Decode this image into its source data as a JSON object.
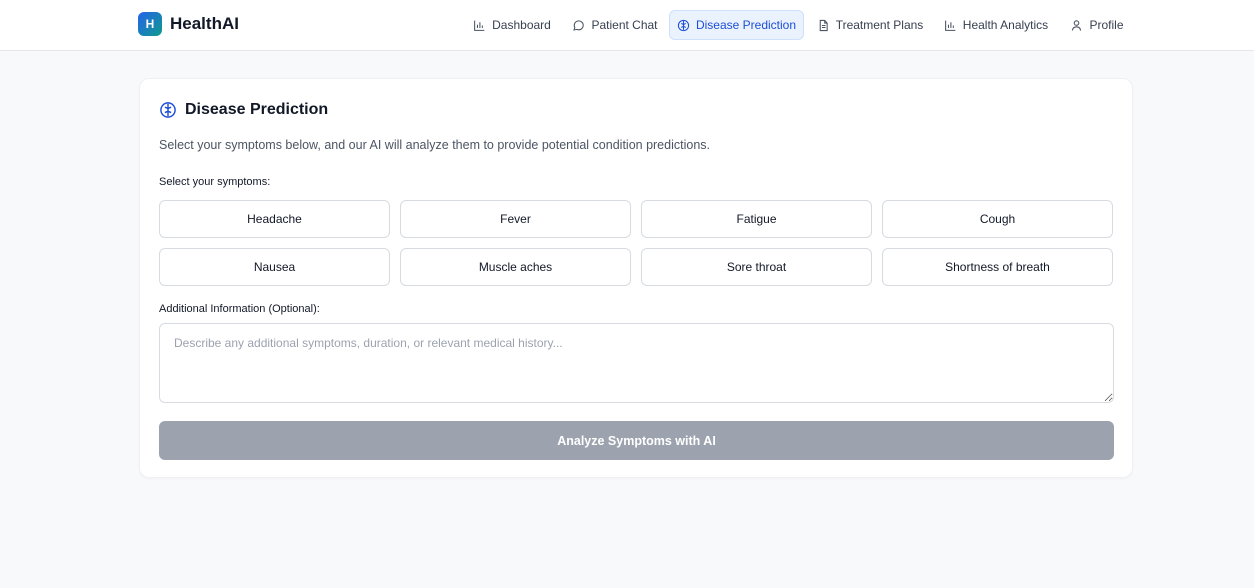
{
  "brand": {
    "logo_letter": "H",
    "name": "HealthAI"
  },
  "nav": [
    {
      "label": "Dashboard",
      "icon": "bar-chart-icon",
      "active": false
    },
    {
      "label": "Patient Chat",
      "icon": "chat-bubble-icon",
      "active": false
    },
    {
      "label": "Disease Prediction",
      "icon": "brain-icon",
      "active": true
    },
    {
      "label": "Treatment Plans",
      "icon": "document-icon",
      "active": false
    },
    {
      "label": "Health Analytics",
      "icon": "bar-chart-icon",
      "active": false
    },
    {
      "label": "Profile",
      "icon": "user-icon",
      "active": false
    }
  ],
  "colors": {
    "accent": "#1d4ed8",
    "active_bg": "#eaf2fe",
    "button_disabled": "#9ca3af"
  },
  "prediction": {
    "title": "Disease Prediction",
    "title_icon": "brain-icon",
    "description": "Select your symptoms below, and our AI will analyze them to provide potential condition predictions.",
    "symptoms_label": "Select your symptoms:",
    "symptoms": [
      "Headache",
      "Fever",
      "Fatigue",
      "Cough",
      "Nausea",
      "Muscle aches",
      "Sore throat",
      "Shortness of breath"
    ],
    "additional_label": "Additional Information (Optional):",
    "additional_placeholder": "Describe any additional symptoms, duration, or relevant medical history...",
    "additional_value": "",
    "analyze_label": "Analyze Symptoms with AI"
  }
}
